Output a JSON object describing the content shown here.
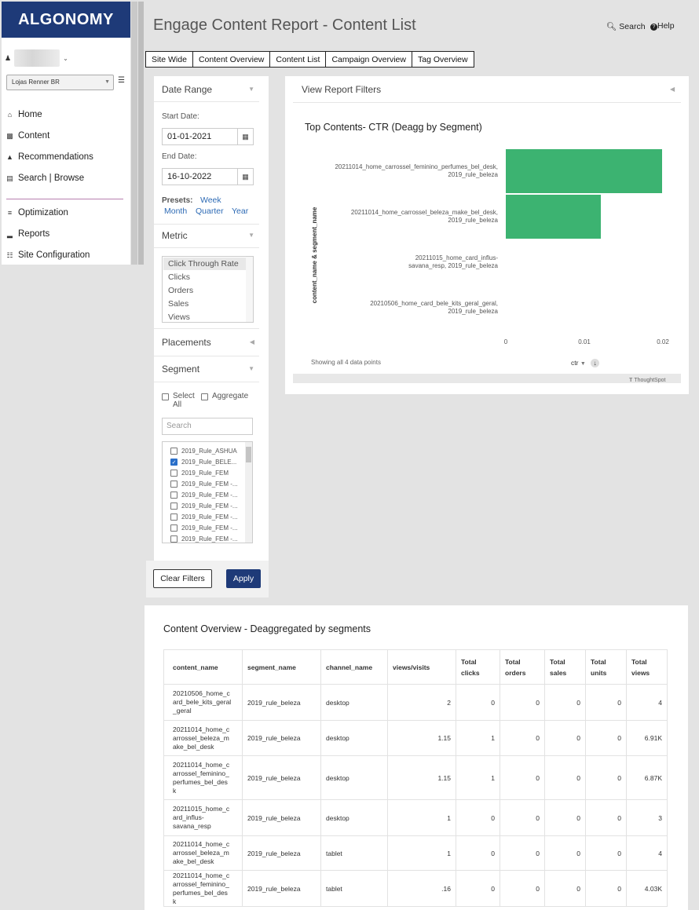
{
  "brand": {
    "logo_text": "ALGONOMY",
    "accent": "#1e3a78",
    "chart_color": "#3cb371"
  },
  "sidebar": {
    "site_select": "Lojas Renner BR",
    "items": [
      {
        "label": "Home",
        "icon": "home-icon"
      },
      {
        "label": "Content",
        "icon": "content-icon"
      },
      {
        "label": "Recommendations",
        "icon": "sitemap-icon"
      },
      {
        "label": "Search | Browse",
        "icon": "search-browse-icon"
      },
      {
        "label": "Optimization",
        "icon": "sliders-icon"
      },
      {
        "label": "Reports",
        "icon": "chart-icon"
      },
      {
        "label": "Site Configuration",
        "icon": "config-icon"
      }
    ]
  },
  "header": {
    "title": "Engage Content Report - Content List",
    "search_label": "Search",
    "help_label": "Help"
  },
  "tabs": [
    "Site Wide",
    "Content Overview",
    "Content List",
    "Campaign Overview",
    "Tag Overview"
  ],
  "filters": {
    "date_range_label": "Date Range",
    "start_label": "Start Date:",
    "start_value": "01-01-2021",
    "end_label": "End Date:",
    "end_value": "16-10-2022",
    "presets_label": "Presets:",
    "presets": [
      "Week",
      "Month",
      "Quarter",
      "Year"
    ],
    "metric_label": "Metric",
    "metrics": [
      "Click Through Rate",
      "Clicks",
      "Orders",
      "Sales",
      "Views"
    ],
    "placements_label": "Placements",
    "segment_label": "Segment",
    "select_all": "Select All",
    "aggregate": "Aggregate",
    "search_placeholder": "Search",
    "segments": [
      "2019_Rule_ASHUA",
      "2019_Rule_BELE...",
      "2019_Rule_FEM",
      "2019_Rule_FEM -...",
      "2019_Rule_FEM -...",
      "2019_Rule_FEM -...",
      "2019_Rule_FEM -...",
      "2019_Rule_FEM -...",
      "2019_Rule_FEM -..."
    ],
    "clear_label": "Clear Filters",
    "apply_label": "Apply"
  },
  "report_filters": {
    "label": "View Report Filters"
  },
  "chart_data": {
    "type": "bar",
    "orientation": "horizontal",
    "title": "Top Contents- CTR (Deagg by Segment)",
    "ylabel": "content_name & segment_name",
    "xlabel": "ctr",
    "categories": [
      [
        "20211014_home_carrossel_feminino_perfumes_bel_desk,",
        "2019_rule_beleza"
      ],
      [
        "20211014_home_carrossel_beleza_make_bel_desk,",
        "2019_rule_beleza"
      ],
      [
        "20211015_home_card_influs-",
        "savana_resp, 2019_rule_beleza"
      ],
      [
        "20210506_home_card_bele_kits_geral_geral,",
        "2019_rule_beleza"
      ]
    ],
    "values": [
      0.0199,
      0.0121,
      0,
      0
    ],
    "xlim": [
      0,
      0.02
    ],
    "xticks": [
      "0",
      "0.01",
      "0.02"
    ],
    "footer": "Showing all 4 data points",
    "vendor": "ThoughtSpot"
  },
  "table": {
    "title": "Content Overview - Deaggregated by segments",
    "headers": [
      "content_name",
      "segment_name",
      "channel_name",
      "views/visits",
      "Total clicks",
      "Total orders",
      "Total sales",
      "Total units",
      "Total views"
    ],
    "rows": [
      [
        "20210506_home_c\nard_bele_kits_geral\n_geral",
        "2019_rule_beleza",
        "desktop",
        "2",
        "0",
        "0",
        "0",
        "0",
        "4"
      ],
      [
        "20211014_home_c\narrossel_beleza_m\nake_bel_desk",
        "2019_rule_beleza",
        "desktop",
        "1.15",
        "1",
        "0",
        "0",
        "0",
        "6.91K"
      ],
      [
        "20211014_home_c\narrossel_feminino_\nperfumes_bel_des\nk",
        "2019_rule_beleza",
        "desktop",
        "1.15",
        "1",
        "0",
        "0",
        "0",
        "6.87K"
      ],
      [
        "20211015_home_c\nard_influs-\nsavana_resp",
        "2019_rule_beleza",
        "desktop",
        "1",
        "0",
        "0",
        "0",
        "0",
        "3"
      ],
      [
        "20211014_home_c\narrossel_beleza_m\nake_bel_desk",
        "2019_rule_beleza",
        "tablet",
        "1",
        "0",
        "0",
        "0",
        "0",
        "4"
      ],
      [
        "20211014_home_c\narrossel_feminino_\nperfumes_bel_des\nk",
        "2019_rule_beleza",
        "tablet",
        ".16",
        "0",
        "0",
        "0",
        "0",
        "4.03K"
      ]
    ]
  }
}
